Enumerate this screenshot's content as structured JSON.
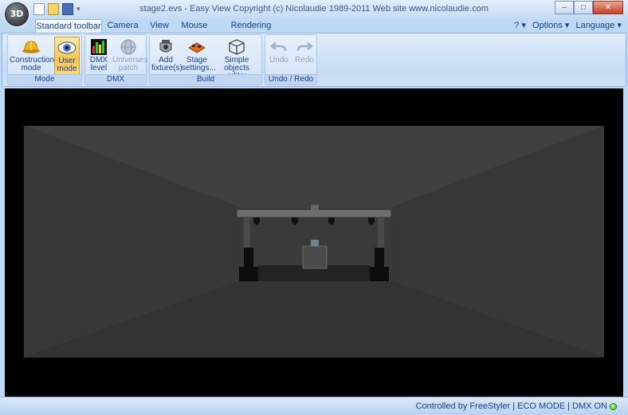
{
  "app": {
    "orb_label": "3D",
    "title": "stage2.evs - Easy View   Copyright (c) Nicolaudie 1989-2011   Web site www.nicolaudie.com"
  },
  "window_buttons": {
    "minimize": "–",
    "maximize": "□",
    "close": "✕"
  },
  "quick_access": {
    "dropdown": "▾"
  },
  "tabs": [
    {
      "label": "Standard toolbar",
      "active": true
    },
    {
      "label": "Camera"
    },
    {
      "label": "View"
    },
    {
      "label": "Mouse"
    },
    {
      "label": "Rendering options"
    }
  ],
  "right_menu": {
    "help": "? ▾",
    "options": "Options ▾",
    "language": "Language ▾"
  },
  "ribbon": {
    "mode": {
      "label": "Mode",
      "construction": "Construction mode",
      "user": "User mode"
    },
    "dmx": {
      "label": "DMX",
      "level": "DMX level",
      "universes": "Universes patch"
    },
    "build": {
      "label": "Build",
      "add": "Add fixture(s)",
      "stage": "Stage settings...",
      "simple": "Simple objects editor"
    },
    "undo": {
      "label": "Undo / Redo",
      "undo": "Undo",
      "redo": "Redo"
    }
  },
  "status": {
    "text": "Controlled by FreeStyler  |  ECO MODE  |  DMX ON",
    "led_color": "#2fb81a",
    "grip": "⋰"
  }
}
